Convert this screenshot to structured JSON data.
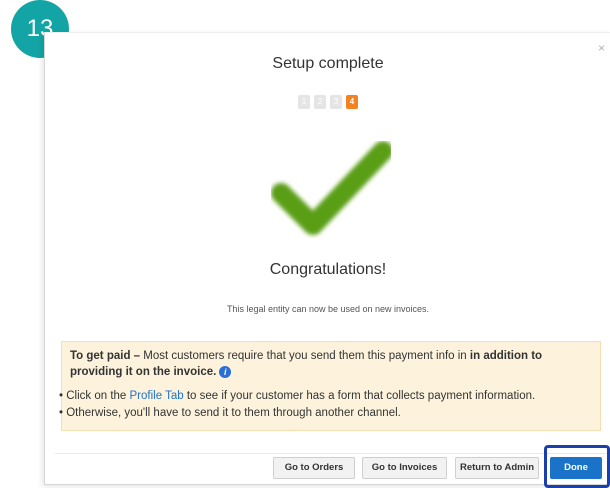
{
  "badge": {
    "number": "13",
    "color": "#13a5a5"
  },
  "modal": {
    "close_label": "×",
    "title": "Setup complete",
    "steps": [
      "1",
      "2",
      "3",
      "4"
    ],
    "active_step": "4",
    "icon": "checkmark-icon",
    "congrats": "Congratulations!",
    "subtitle": "This legal entity can now be used on new invoices."
  },
  "notice": {
    "lead_bold": "To get paid –",
    "lead_text": " Most customers require that you send them this payment info in ",
    "lead_bold2": "in addition to",
    "line2_bold": "providing it on the invoice.",
    "info_icon": "i",
    "bullet1_pre": "• Click on the ",
    "bullet1_link": "Profile Tab",
    "bullet1_post": " to see if your customer has a form that collects payment information.",
    "bullet2": "• Otherwise, you'll have to send it to them through another channel."
  },
  "footer": {
    "go_to_orders": "Go to Orders",
    "go_to_invoices": "Go to Invoices",
    "return_to_admin": "Return to Admin",
    "done": "Done"
  },
  "colors": {
    "accent": "#1a73c9",
    "step_active": "#f58220",
    "check_green": "#5a9e12",
    "notice_bg": "#fdf3dd",
    "highlight": "#1c3fae"
  }
}
